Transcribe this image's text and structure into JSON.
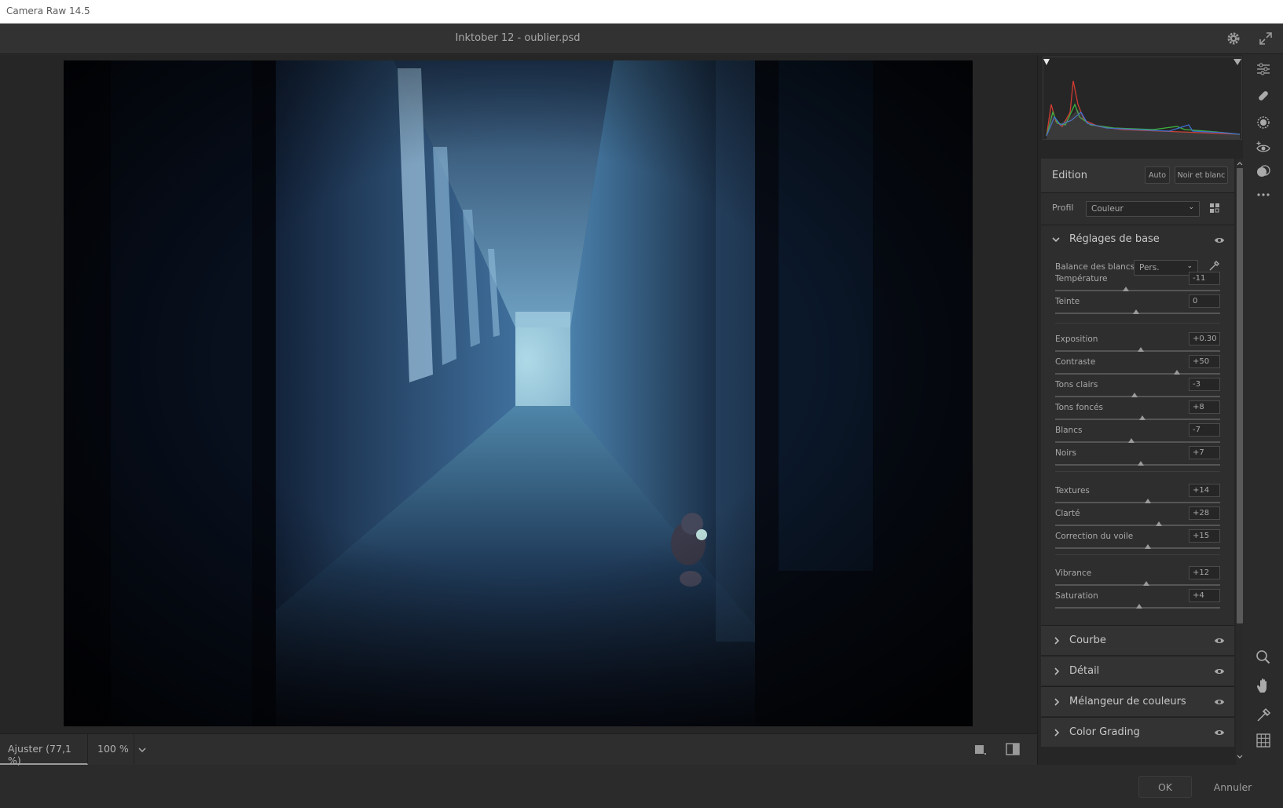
{
  "window": {
    "app_title": "Camera Raw 14.5"
  },
  "document": {
    "title": "Inktober 12 - oublier.psd"
  },
  "canvas_footer": {
    "zoom_fit": "Ajuster (77,1 %)",
    "zoom_100": "100 %"
  },
  "footer": {
    "ok": "OK",
    "cancel": "Annuler"
  },
  "edition": {
    "title": "Edition",
    "auto": "Auto",
    "bw": "Noir et blanc",
    "profile_label": "Profil",
    "profile_value": "Couleur"
  },
  "basic": {
    "title": "Réglages de base",
    "wb_label": "Balance des blancs",
    "wb_value": "Pers.",
    "sliders": [
      {
        "label": "Température",
        "value": "-11",
        "position": 0.43
      },
      {
        "label": "Teinte",
        "value": "0",
        "position": 0.49
      },
      {
        "label": "Exposition",
        "value": "+0.30",
        "position": 0.52
      },
      {
        "label": "Contraste",
        "value": "+50",
        "position": 0.74
      },
      {
        "label": "Tons clairs",
        "value": "-3",
        "position": 0.48
      },
      {
        "label": "Tons foncés",
        "value": "+8",
        "position": 0.53
      },
      {
        "label": "Blancs",
        "value": "-7",
        "position": 0.46
      },
      {
        "label": "Noirs",
        "value": "+7",
        "position": 0.52
      },
      {
        "label": "Textures",
        "value": "+14",
        "position": 0.56
      },
      {
        "label": "Clarté",
        "value": "+28",
        "position": 0.63
      },
      {
        "label": "Correction du voile",
        "value": "+15",
        "position": 0.56
      },
      {
        "label": "Vibrance",
        "value": "+12",
        "position": 0.55
      },
      {
        "label": "Saturation",
        "value": "+4",
        "position": 0.51
      }
    ]
  },
  "sections": [
    "Courbe",
    "Détail",
    "Mélangeur de couleurs",
    "Color Grading"
  ],
  "icons": {
    "header": [
      "gear-icon",
      "expand-icon"
    ],
    "tools": [
      "sliders-icon",
      "healing-brush-icon",
      "masking-icon",
      "red-eye-icon",
      "presets-icon",
      "more-icon",
      "zoom-icon",
      "hand-icon",
      "color-sampler-icon",
      "grid-icon"
    ]
  },
  "colors": {
    "accent_panel": "#2e2e2e",
    "histogram_red": "#d23c32",
    "histogram_green": "#3cb43c",
    "histogram_blue": "#3c6ed2"
  }
}
